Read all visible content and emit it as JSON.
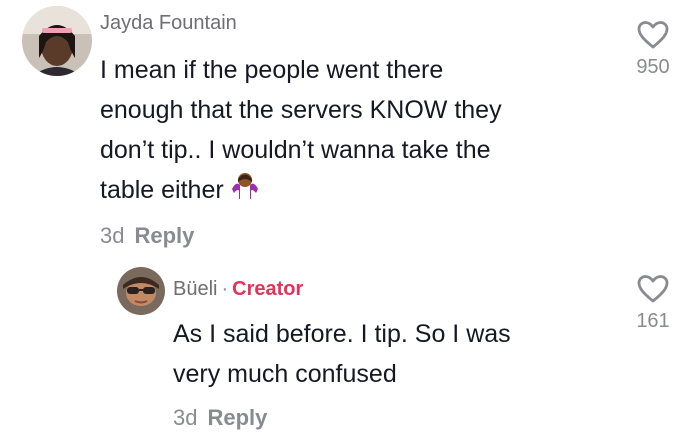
{
  "comments": [
    {
      "username": "Jayda Fountain",
      "text_lines": [
        "I mean if the people went there",
        "enough that the servers KNOW they",
        "don’t tip.. I wouldn’t wanna take the",
        "table either"
      ],
      "emoji_icon": "person-shrugging-emoji",
      "age": "3d",
      "reply_label": "Reply",
      "like_count": "950",
      "like_icon": "heart-outline-icon"
    },
    {
      "username": "Büeli",
      "separator": "·",
      "badge": "Creator",
      "badge_color": "#e4335a",
      "text_lines": [
        "As I said before. I tip. So I was",
        "very much confused"
      ],
      "age": "3d",
      "reply_label": "Reply",
      "like_count": "161",
      "like_icon": "heart-outline-icon"
    }
  ]
}
